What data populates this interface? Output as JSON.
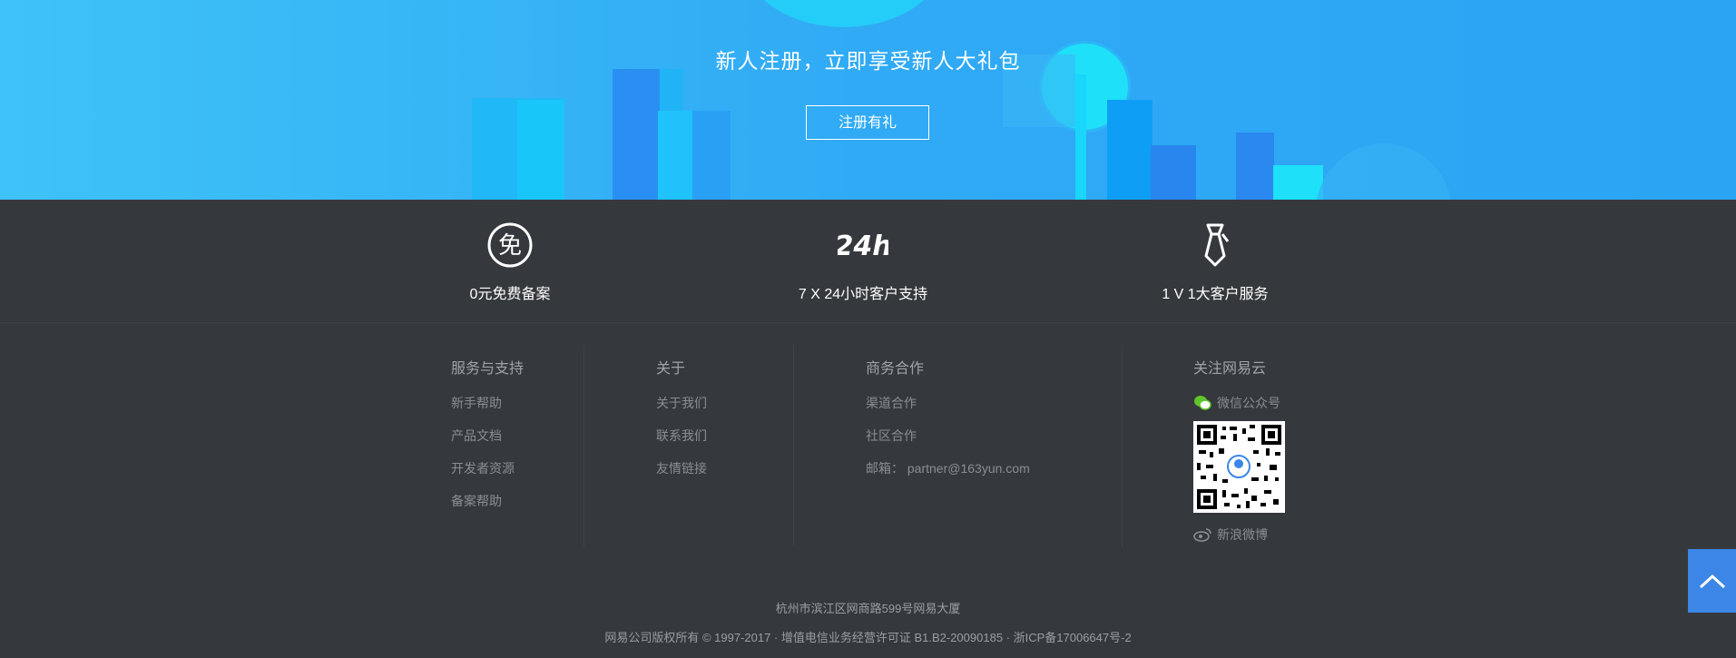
{
  "banner": {
    "title": "新人注册，立即享受新人大礼包",
    "button_label": "注册有礼"
  },
  "features": [
    {
      "icon": "free-icon",
      "label": "0元免费备案"
    },
    {
      "icon": "24h-icon",
      "label": "7 X 24小时客户支持"
    },
    {
      "icon": "tie-icon",
      "label": "1 V 1大客户服务"
    }
  ],
  "columns": {
    "service": {
      "title": "服务与支持",
      "items": [
        "新手帮助",
        "产品文档",
        "开发者资源",
        "备案帮助"
      ]
    },
    "about": {
      "title": "关于",
      "items": [
        "关于我们",
        "联系我们",
        "友情链接"
      ]
    },
    "business": {
      "title": "商务合作",
      "items": [
        "渠道合作",
        "社区合作",
        "邮箱： partner@163yun.com"
      ]
    },
    "follow": {
      "title": "关注网易云",
      "wechat_label": "微信公众号",
      "weibo_label": "新浪微博"
    }
  },
  "footer": {
    "address": "杭州市滨江区网商路599号网易大厦",
    "copyright": "网易公司版权所有 © 1997-2017 · 增值电信业务经营许可证 B1.B2-20090185 · 浙ICP备17006647号-2"
  },
  "colors": {
    "banner_start": "#3ec2f7",
    "banner_end": "#2ba4f4",
    "footer_bg": "#35383c",
    "back_to_top": "#3b86e6"
  }
}
